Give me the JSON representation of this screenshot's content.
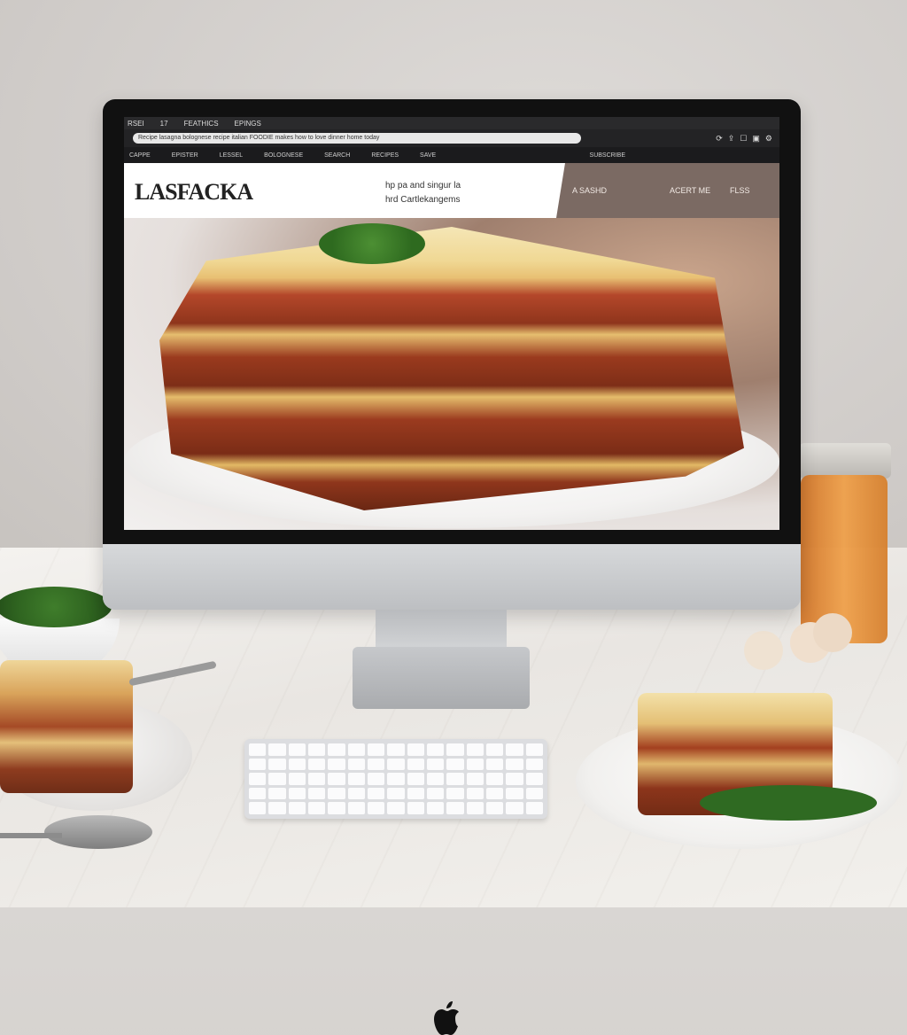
{
  "browser": {
    "topbar_items": [
      "RSEI",
      "17",
      "FEATHICS",
      "EPINGS"
    ],
    "url": "Recipe lasagna bolognese recipe italian FOODIE makes how to love dinner home today",
    "nav_items": [
      "CAPPE",
      "EPISTER",
      "LESSEL",
      "BOLOGNESE",
      "SEARCH",
      "RECIPES",
      "SAVE"
    ],
    "nav_right": "SUBSCRIBE"
  },
  "site": {
    "brand": "LASFACKA",
    "tagline_line1": "hp pa and singur la",
    "tagline_line2": "hrd Cartlekangems",
    "header_right": [
      "A SAS",
      "HD",
      "ACERT ME",
      "FLSS"
    ]
  },
  "monitor": {
    "logo": "apple-logo"
  },
  "colors": {
    "sauce": "#a5381f",
    "pasta": "#e9c27a",
    "cheese": "#f6edd1"
  }
}
